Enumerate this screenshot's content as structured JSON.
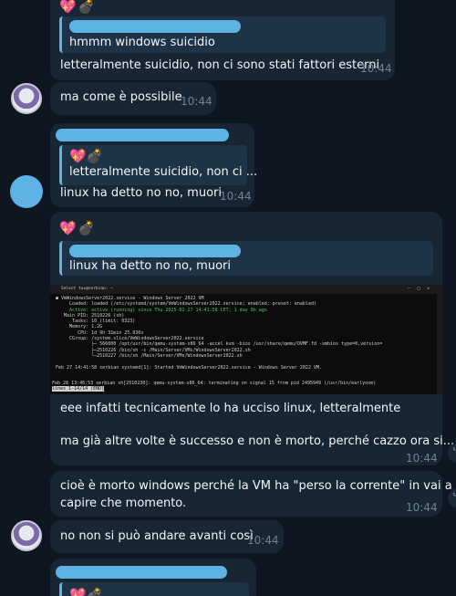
{
  "messages": [
    {
      "id": "m1",
      "quote": "hmmm windows suicidio",
      "text": "letteralmente suicidio, non ci sono stati fattori esterni",
      "time": "10:44"
    },
    {
      "id": "m2",
      "text": "ma come è possibile",
      "time": "10:44"
    },
    {
      "id": "m3",
      "quote": "letteralmente suicidio, non ci ...",
      "text": "linux ha detto no no, muori",
      "time": "10:44"
    },
    {
      "id": "m4",
      "quote": "linux ha detto no no, muori",
      "text1": "eee infatti tecnicamente lo ha ucciso linux, letteralmente",
      "text2": "ma già altre volte è successo e non è morto, perché cazzo ora si...",
      "time": "10:44"
    },
    {
      "id": "m5",
      "text1": "cioè è morto windows perché la VM ha \"perso la corrente\" in vai a",
      "text2": "capire che momento.",
      "time": "10:44"
    },
    {
      "id": "m6",
      "text": "no non si può andare avanti così",
      "time": "10:44"
    }
  ],
  "emojis": {
    "heart": "💖",
    "bomb": "💣"
  },
  "terminal": {
    "title": "Select tux@serbian: ~",
    "lines": [
      "● VmWindowsServer2022.service - Windows Server 2022 VM",
      "     Loaded: loaded (/etc/systemd/system/VmWindowsServer2022.service; enabled; preset: enabled)",
      "     Active: active (running) since Thu 2025-02-27 14:41:58 CET; 1 day 8h ago",
      "   Main PID: 2510226 (sh)",
      "      Tasks: 10 (limit: 0323)",
      "     Memory: 1.2G",
      "        CPU: 1d 9h 31min 25.930s",
      "     CGroup: /system.slice/VmWindowsServer2022.service",
      "             ├─ 566000 /opt/usr/bin/qemu-system-x86_64 -accel kvm -bios /usr/share/qemu/OVMF.fd -smbios type=0,version=",
      "             ├─2510226 /bin/sh -c /Main/Server/VMs/WindowsServer2022.sh",
      "             └─2510227 /bin/sh /Main/Server/VMs/WindowsServer2022.sh",
      "",
      "Feb 27 14:41:58 serbian systemd[1]: Started VmWindowsServer2022.service - Windows Server 2022 VM."
    ],
    "status_line": "Feb 28 13:46:53 serbian sh[2510230]: qemu-system-x86_64: terminating on signal 15 from pid 2495949 (/usr/bin/earlyoom)",
    "pager": "lines 1-14/14 (END)"
  }
}
